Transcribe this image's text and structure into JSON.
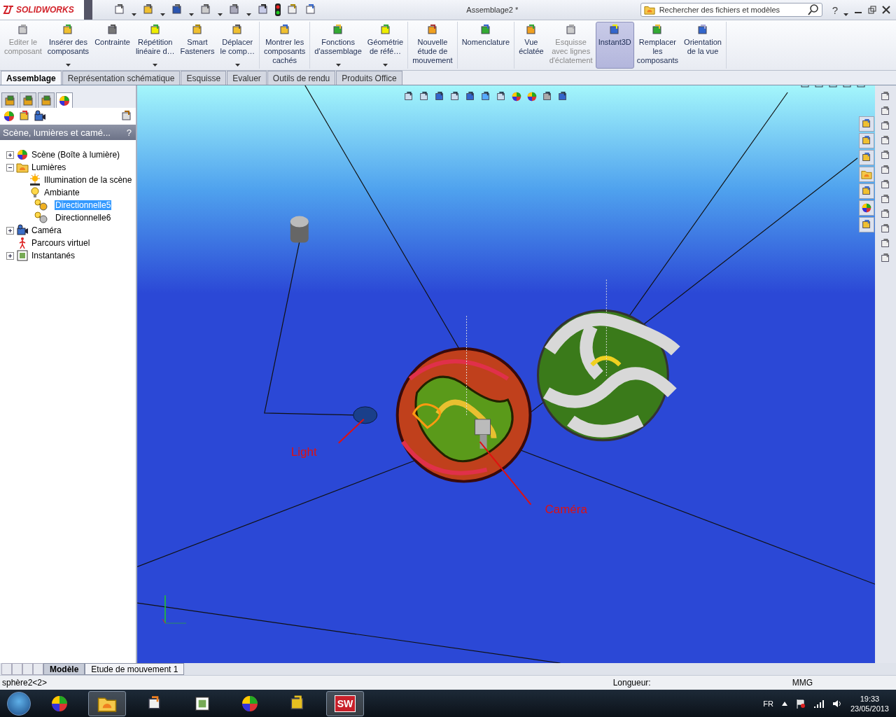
{
  "app": {
    "logo": "SOLIDWORKS",
    "title": "Assemblage2 *",
    "search": {
      "placeholder": "Rechercher des fichiers et modèles"
    },
    "help": "?"
  },
  "ribbon": [
    {
      "items": [
        {
          "label": "Editer le\ncomposant",
          "disabled": true,
          "selected": false,
          "dropdown": false
        },
        {
          "label": "Insérer des\ncomposants",
          "disabled": false,
          "selected": false,
          "dropdown": true
        },
        {
          "label": "Contrainte",
          "disabled": false,
          "selected": false,
          "dropdown": false
        },
        {
          "label": "Répétition\nlinéaire d…",
          "disabled": false,
          "selected": false,
          "dropdown": true
        },
        {
          "label": "Smart\nFasteners",
          "disabled": false,
          "selected": false,
          "dropdown": false
        },
        {
          "label": "Déplacer\nle comp…",
          "disabled": false,
          "selected": false,
          "dropdown": true
        }
      ]
    },
    {
      "items": [
        {
          "label": "Montrer les\ncomposants\ncachés",
          "disabled": false,
          "selected": false,
          "dropdown": false
        }
      ]
    },
    {
      "items": [
        {
          "label": "Fonctions\nd'assemblage",
          "disabled": false,
          "selected": false,
          "dropdown": true
        },
        {
          "label": "Géométrie\nde réfé…",
          "disabled": false,
          "selected": false,
          "dropdown": true
        }
      ]
    },
    {
      "items": [
        {
          "label": "Nouvelle\nétude de\nmouvement",
          "disabled": false,
          "selected": false,
          "dropdown": false
        }
      ]
    },
    {
      "items": [
        {
          "label": "Nomenclature",
          "disabled": false,
          "selected": false,
          "dropdown": false
        }
      ]
    },
    {
      "items": [
        {
          "label": "Vue\néclatée",
          "disabled": false,
          "selected": false,
          "dropdown": false
        },
        {
          "label": "Esquisse\navec lignes\nd'éclatement",
          "disabled": true,
          "selected": false,
          "dropdown": false
        },
        {
          "label": "Instant3D",
          "disabled": false,
          "selected": true,
          "dropdown": false
        },
        {
          "label": "Remplacer\nles\ncomposants",
          "disabled": false,
          "selected": false,
          "dropdown": false
        },
        {
          "label": "Orientation\nde la vue",
          "disabled": false,
          "selected": false,
          "dropdown": false
        }
      ]
    }
  ],
  "tabs": [
    {
      "label": "Assemblage",
      "selected": true
    },
    {
      "label": "Représentation schématique",
      "selected": false
    },
    {
      "label": "Esquisse",
      "selected": false
    },
    {
      "label": "Evaluer",
      "selected": false
    },
    {
      "label": "Outils de rendu",
      "selected": false
    },
    {
      "label": "Produits Office",
      "selected": false
    }
  ],
  "panel": {
    "icon_tabs": [
      {
        "selected": false
      },
      {
        "selected": false
      },
      {
        "selected": false
      },
      {
        "selected": true
      }
    ],
    "title": "Scène, lumières et camé...",
    "help": "?",
    "tree": [
      {
        "label": "Scène (Boîte à lumière)",
        "kind": "scene",
        "expanded": false,
        "selected": false
      },
      {
        "label": "Lumières",
        "kind": "folder",
        "expanded": true,
        "selected": false,
        "children": [
          {
            "label": "Illumination de la scène",
            "kind": "sun",
            "selected": false
          },
          {
            "label": "Ambiante",
            "kind": "bulb",
            "selected": false
          },
          {
            "label": "Directionnelle5",
            "kind": "directional",
            "selected": true
          },
          {
            "label": "Directionnelle6",
            "kind": "directional",
            "selected": false
          }
        ]
      },
      {
        "label": "Caméra",
        "kind": "camera",
        "expanded": false,
        "selected": false
      },
      {
        "label": "Parcours virtuel",
        "kind": "walk",
        "selected": false
      },
      {
        "label": "Instantanés",
        "kind": "snapshot",
        "expanded": false,
        "selected": false
      }
    ]
  },
  "viewport": {
    "annotations": [
      {
        "text": "Light"
      },
      {
        "text": "Caméra"
      }
    ]
  },
  "bottom_tabs": [
    {
      "label": "Modèle",
      "selected": true
    },
    {
      "label": "Etude de mouvement 1",
      "selected": false
    }
  ],
  "status_bar": {
    "selection": "sphère2<2>",
    "length": "Longueur:",
    "units": "MMG"
  },
  "taskbar": {
    "app_badge": "SW",
    "language": "FR",
    "time": "19:33",
    "date": "23/05/2013"
  }
}
